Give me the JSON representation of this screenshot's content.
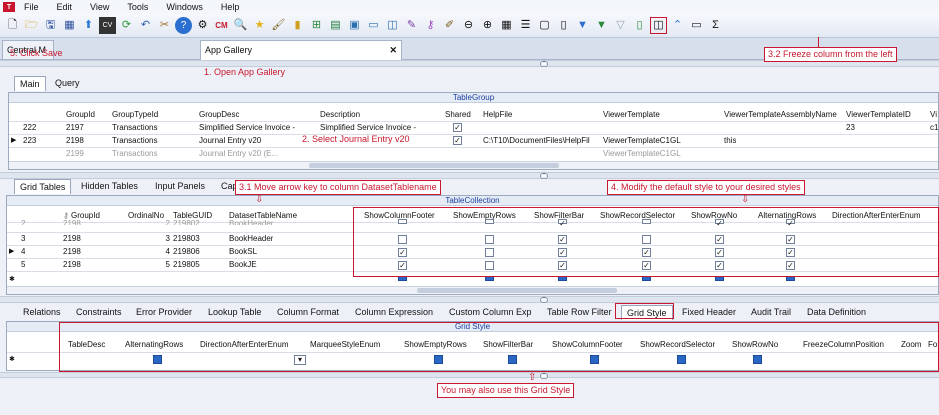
{
  "menubar": {
    "items": [
      "File",
      "Edit",
      "View",
      "Tools",
      "Windows",
      "Help"
    ]
  },
  "toolbar": {
    "icons": [
      "new-icon",
      "open-icon",
      "save-icon",
      "save-all-icon",
      "upload-icon",
      "cv-icon",
      "refresh-icon",
      "undo-icon",
      "tools-icon",
      "help-icon",
      "gear-icon",
      "cm-icon",
      "search-icon",
      "star-icon",
      "brush-icon",
      "chart-icon",
      "tree-icon",
      "excel-icon",
      "image-icon",
      "monitor-icon",
      "window-icon",
      "pencil-icon",
      "key-icon",
      "edit-icon",
      "zoom-out-icon",
      "zoom-in-icon",
      "grid-icon",
      "list-icon",
      "doc-icon",
      "page-icon",
      "filter-icon",
      "filter-add-icon",
      "filter-clear-icon",
      "report-icon",
      "freeze-column-icon",
      "up-icon",
      "window-sm-icon",
      "sum-icon"
    ]
  },
  "doctabs": {
    "central": "Central M",
    "app_gallery": "App Gallery",
    "close": "✕"
  },
  "top_subtabs": {
    "main": "Main",
    "query": "Query"
  },
  "tablegroup": {
    "caption": "TableGroup",
    "headers": [
      "GroupId",
      "GroupTypeId",
      "GroupDesc",
      "Description",
      "Shared",
      "HelpFile",
      "ViewerTemplate",
      "ViewerTemplateAssemblyName",
      "ViewerTemplateID",
      "Vi"
    ],
    "rows": [
      [
        "222",
        "2197",
        "Transactions",
        "Simplified Service Invoice -",
        "Simplified Service Invoice -",
        "",
        "",
        "",
        "23",
        "c1"
      ],
      [
        "223",
        "2198",
        "Transactions",
        "Journal Entry v20",
        "",
        "C:\\T10\\DocumentFiles\\HelpFil",
        "ViewerTemplateC1GL",
        "this",
        "",
        ""
      ],
      [
        "",
        "2199",
        "Transactions",
        "Journal Entry v20 (E...",
        "",
        "",
        "ViewerTemplateC1GL",
        "",
        "",
        ""
      ]
    ]
  },
  "mid_subtabs": [
    "Grid Tables",
    "Hidden Tables",
    "Input Panels",
    "Cap"
  ],
  "tablecollection": {
    "caption": "TableCollection",
    "headers": [
      "GroupId",
      "OrdinalNo",
      "TableGUID",
      "DatasetTableName",
      "ShowColumnFooter",
      "ShowEmptyRows",
      "ShowFilterBar",
      "ShowRecordSelector",
      "ShowRowNo",
      "AlternatingRows",
      "DirectionAfterEnterEnum"
    ],
    "rows": [
      [
        "2",
        "2198",
        "2",
        "219802",
        "BookHeader"
      ],
      [
        "3",
        "2198",
        "3",
        "219803",
        "BookHeader"
      ],
      [
        "4",
        "2198",
        "4",
        "219806",
        "BookSL"
      ],
      [
        "5",
        "2198",
        "5",
        "219805",
        "BookJE"
      ]
    ],
    "checks": [
      [
        false,
        false,
        true,
        false,
        true,
        true
      ],
      [
        false,
        false,
        true,
        false,
        true,
        true
      ],
      [
        true,
        false,
        true,
        true,
        true,
        true
      ],
      [
        true,
        false,
        true,
        true,
        true,
        true
      ]
    ]
  },
  "bottom_tabs": [
    "Relations",
    "Constraints",
    "Error Provider",
    "Lookup Table",
    "Column Format",
    "Column Expression",
    "Custom Column Exp",
    "Table Row Filter",
    "Grid Style",
    "Fixed Header",
    "Audit Trail",
    "Data Definition"
  ],
  "gridstyle": {
    "caption": "Grid Style",
    "headers": [
      "TableDesc",
      "AlternatingRows",
      "DirectionAfterEnterEnum",
      "MarqueeStyleEnum",
      "ShowEmptyRows",
      "ShowFilterBar",
      "ShowColumnFooter",
      "ShowRecordSelector",
      "ShowRowNo",
      "FreezeColumnPosition",
      "Zoom",
      "Fo"
    ]
  },
  "annotations": {
    "a1": "1. Open App Gallery",
    "a2": "2. Select Journal Entry v20",
    "a31": "3.1 Move arrow key to column DatasetTablename",
    "a32": "3.2 Freeze column from the left",
    "a4": "4. Modify the default style to your desired styles",
    "a5": "5. Click Save",
    "a6": "You may also use this Grid Style"
  },
  "colors": {
    "annotation": "#c8172e",
    "caption": "#1a3fa0",
    "checkbox_blue": "#2a66c4"
  }
}
